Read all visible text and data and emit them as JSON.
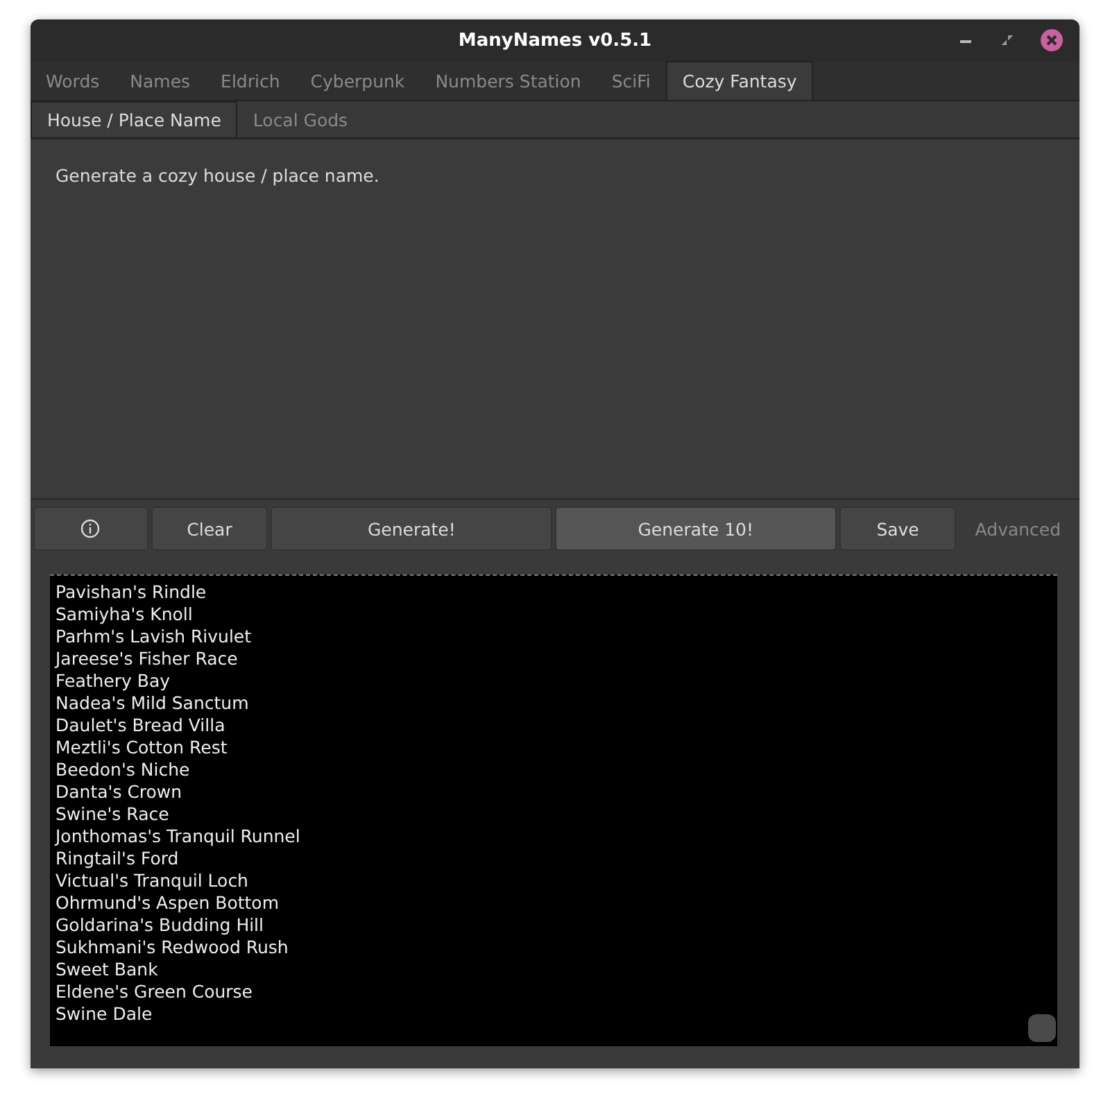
{
  "window": {
    "title": "ManyNames v0.5.1"
  },
  "tabs": [
    {
      "label": "Words",
      "selected": false
    },
    {
      "label": "Names",
      "selected": false
    },
    {
      "label": "Eldrich",
      "selected": false
    },
    {
      "label": "Cyberpunk",
      "selected": false
    },
    {
      "label": "Numbers Station",
      "selected": false
    },
    {
      "label": "SciFi",
      "selected": false
    },
    {
      "label": "Cozy Fantasy",
      "selected": true
    }
  ],
  "subtabs": [
    {
      "label": "House / Place Name",
      "selected": true
    },
    {
      "label": "Local Gods",
      "selected": false
    }
  ],
  "description": "Generate a cozy house / place name.",
  "buttons": [
    {
      "kind": "icon",
      "disabled": false,
      "highlighted": false
    },
    {
      "kind": "text",
      "label": "Clear",
      "disabled": false,
      "highlighted": false
    },
    {
      "kind": "text",
      "label": "Generate!",
      "disabled": false,
      "highlighted": false
    },
    {
      "kind": "text",
      "label": "Generate 10!",
      "disabled": false,
      "highlighted": true
    },
    {
      "kind": "text",
      "label": "Save",
      "disabled": false,
      "highlighted": false
    },
    {
      "kind": "text",
      "label": "Advanced",
      "disabled": true,
      "highlighted": false
    }
  ],
  "output": [
    "Pavishan's Rindle",
    "Samiyha's Knoll",
    "Parhm's Lavish Rivulet",
    "Jareese's Fisher Race",
    "Feathery Bay",
    "Nadea's Mild Sanctum",
    "Daulet's Bread Villa",
    "Meztli's Cotton Rest",
    "Beedon's Niche",
    "Danta's Crown",
    "Swine's Race",
    "Jonthomas's Tranquil Runnel",
    "Ringtail's Ford",
    "Victual's Tranquil Loch",
    "Ohrmund's Aspen Bottom",
    "Goldarina's Budding Hill",
    "Sukhmani's Redwood Rush",
    "Sweet Bank",
    "Eldene's Green Course",
    "Swine Dale"
  ]
}
